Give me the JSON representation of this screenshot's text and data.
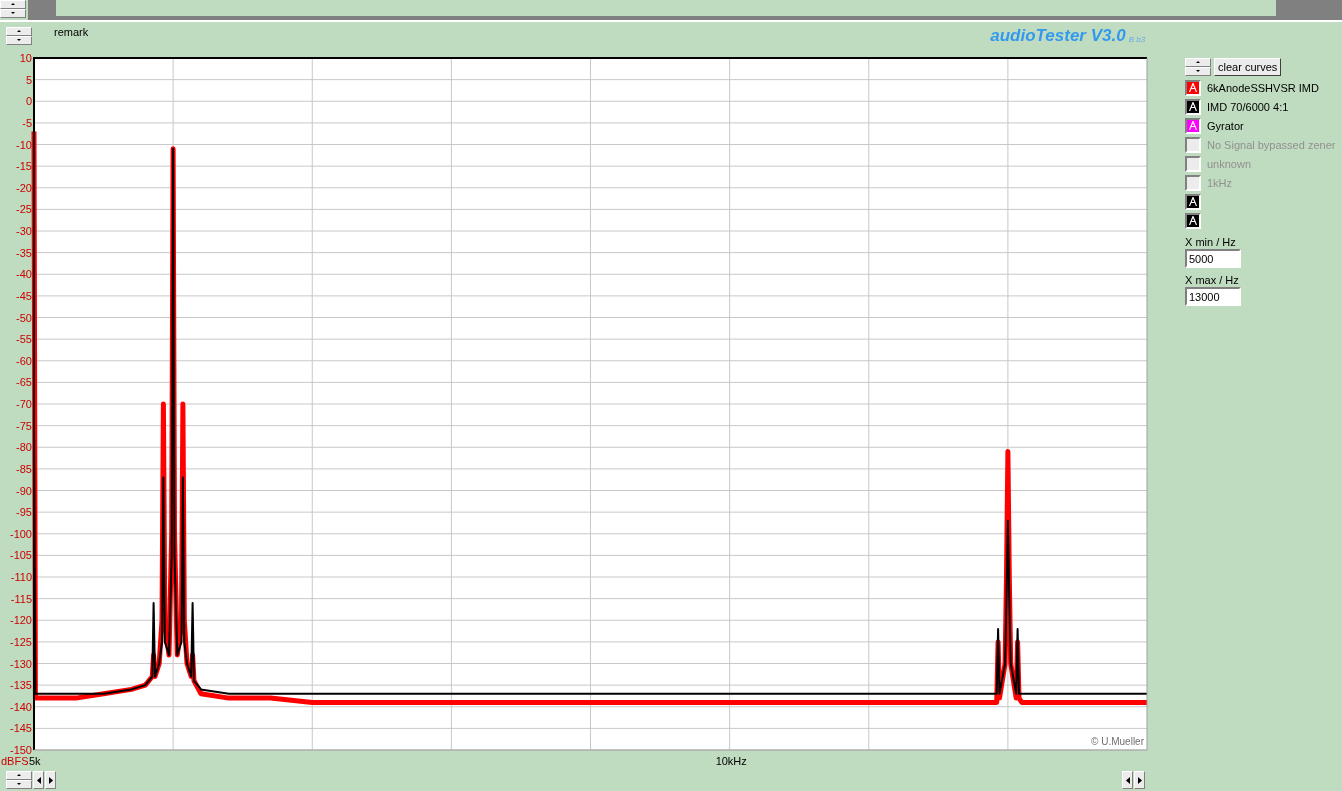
{
  "header": {
    "remark": "remark",
    "title": "audioTester V3.0",
    "build": "B b3"
  },
  "legend": {
    "clear_button": "clear curves",
    "items": [
      {
        "label": "6kAnodeSSHVSR IMD",
        "enabled": true,
        "color": "#ff0000"
      },
      {
        "label": "IMD 70/6000 4:1",
        "enabled": true,
        "color": "#000000"
      },
      {
        "label": "Gyrator",
        "enabled": true,
        "color": "#ff00ff"
      },
      {
        "label": "No Signal bypassed zener",
        "enabled": false
      },
      {
        "label": "unknown",
        "enabled": false
      },
      {
        "label": "1kHz",
        "enabled": false
      },
      {
        "enabled": true,
        "color": "#000000"
      },
      {
        "enabled": true,
        "color": "#000000"
      }
    ]
  },
  "fields": [
    {
      "label": "X min / Hz",
      "value": "5000"
    },
    {
      "label": "X max / Hz",
      "value": "13000"
    }
  ],
  "chart": {
    "copyright": "© U.Mueller",
    "chart_data": {
      "type": "line",
      "ylabel": "dBFS",
      "grid": true,
      "xlim": [
        5,
        13
      ],
      "ylim": [
        -150,
        10
      ],
      "xticks": [
        {
          "value": 5,
          "label": "5k"
        },
        {
          "value": 10,
          "label": "10kHz"
        }
      ],
      "yticks": [
        10,
        5,
        0,
        -5,
        -10,
        -15,
        -20,
        -25,
        -30,
        -35,
        -40,
        -45,
        -50,
        -55,
        -60,
        -65,
        -70,
        -75,
        -80,
        -85,
        -90,
        -95,
        -100,
        -105,
        -110,
        -115,
        -120,
        -125,
        -130,
        -135,
        -140,
        -145,
        -150
      ],
      "x": [
        5,
        5.01,
        5.1,
        5.3,
        5.5,
        5.7,
        5.8,
        5.85,
        5.86,
        5.87,
        5.9,
        5.92,
        5.93,
        5.94,
        5.97,
        5.99,
        6,
        6.01,
        6.03,
        6.06,
        6.07,
        6.08,
        6.1,
        6.13,
        6.14,
        6.15,
        6.2,
        6.4,
        6.7,
        7,
        7.5,
        8,
        8.5,
        9,
        9.5,
        10,
        10.5,
        11,
        11.5,
        11.9,
        11.92,
        11.93,
        11.94,
        11.98,
        11.99,
        12,
        12.01,
        12.02,
        12.06,
        12.07,
        12.08,
        12.1,
        12.5,
        13
      ],
      "series": [
        {
          "color": "#ff0000",
          "values": [
            -7,
            -138,
            -138,
            -138,
            -137,
            -136,
            -135,
            -133,
            -128,
            -133,
            -130,
            -120,
            -70,
            -120,
            -128,
            -100,
            -11,
            -100,
            -128,
            -120,
            -70,
            -120,
            -130,
            -133,
            -128,
            -134,
            -137,
            -138,
            -138,
            -139,
            -139,
            -139,
            -139,
            -139,
            -139,
            -139,
            -139,
            -139,
            -139,
            -139,
            -139,
            -125,
            -138,
            -130,
            -110,
            -81,
            -110,
            -130,
            -138,
            -125,
            -138,
            -139,
            -139,
            -139
          ]
        },
        {
          "color": "#000000",
          "values": [
            -73,
            -137,
            -137,
            -137,
            -137,
            -136,
            -135,
            -133,
            -116,
            -133,
            -130,
            -125,
            -87,
            -125,
            -128,
            -105,
            -11,
            -105,
            -128,
            -125,
            -87,
            -125,
            -130,
            -133,
            -116,
            -134,
            -136,
            -137,
            -137,
            -137,
            -137,
            -137,
            -137,
            -137,
            -137,
            -137,
            -137,
            -137,
            -137,
            -137,
            -137,
            -122,
            -137,
            -130,
            -115,
            -97,
            -115,
            -130,
            -137,
            -122,
            -137,
            -137,
            -137,
            -137
          ]
        }
      ]
    }
  }
}
